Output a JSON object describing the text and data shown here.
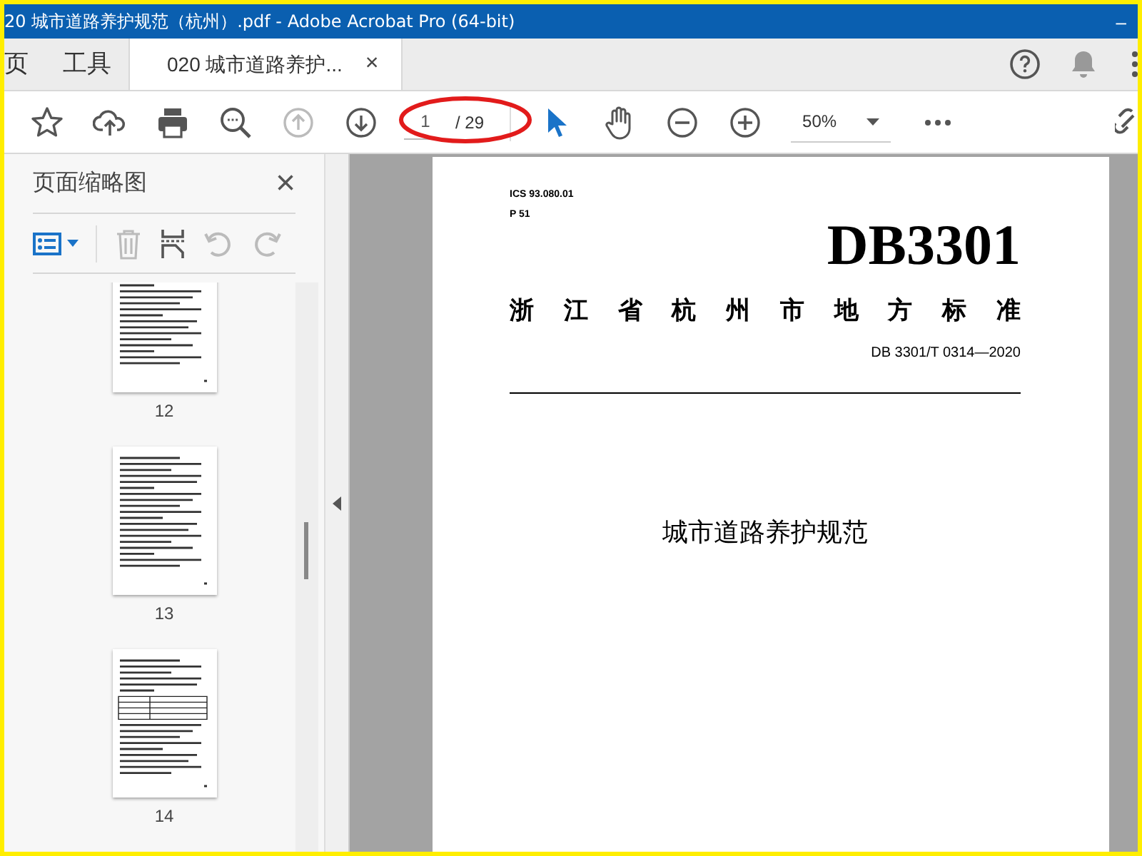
{
  "window": {
    "title": "20 城市道路养护规范（杭州）.pdf - Adobe Acrobat Pro (64-bit)",
    "minimize": "–"
  },
  "tabs": [
    {
      "label": "页",
      "selected": false
    },
    {
      "label": "工具",
      "selected": false
    },
    {
      "label": "020 城市道路养护...",
      "selected": true,
      "close": "×"
    }
  ],
  "toolbar": {
    "page_number": "1",
    "page_total": "/ 29",
    "zoom": "50%"
  },
  "thumbnail_panel": {
    "title": "页面缩略图",
    "close": "×",
    "thumbnails": [
      {
        "label": "12",
        "kind": "text"
      },
      {
        "label": "13",
        "kind": "text"
      },
      {
        "label": "14",
        "kind": "table"
      }
    ]
  },
  "document": {
    "ics": "ICS 93.080.01",
    "ccs": "P 51",
    "code": "DB3301",
    "issuer": "浙 江 省 杭 州 市 地 方 标 准",
    "number": "DB 3301/T 0314—2020",
    "title": "城市道路养护规范"
  }
}
